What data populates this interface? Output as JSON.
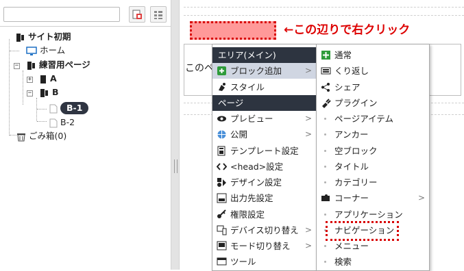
{
  "tree": {
    "nodes": [
      {
        "label": "サイト初期",
        "bold": true
      },
      {
        "label": "ホーム",
        "bold": false
      },
      {
        "label": "練習用ページ",
        "bold": true
      },
      {
        "label": "A",
        "bold": true
      },
      {
        "label": "B",
        "bold": true
      },
      {
        "label": "B-1",
        "selected": true
      },
      {
        "label": "B-2",
        "bold": false
      },
      {
        "label": "ごみ箱(0)",
        "bold": false
      }
    ]
  },
  "page": {
    "annotation": "←この辺りで右クリック",
    "content_text": "このペ"
  },
  "menu_main": {
    "items": [
      {
        "label": "エリア(メイン)",
        "type": "header",
        "icon": ""
      },
      {
        "label": "ブロック追加",
        "type": "item",
        "icon": "plus-square-icon",
        "submenu": true,
        "hover": true
      },
      {
        "label": "スタイル",
        "type": "item",
        "icon": "paint-icon"
      },
      {
        "label": "ページ",
        "type": "header",
        "icon": ""
      },
      {
        "label": "プレビュー",
        "type": "item",
        "icon": "eye-icon",
        "submenu": true
      },
      {
        "label": "公開",
        "type": "item",
        "icon": "globe-icon",
        "submenu": true
      },
      {
        "label": "テンプレート設定",
        "type": "item",
        "icon": "template-icon"
      },
      {
        "label": "<head>設定",
        "type": "item",
        "icon": "code-arrows-icon"
      },
      {
        "label": "デザイン設定",
        "type": "item",
        "icon": "design-icon"
      },
      {
        "label": "出力先設定",
        "type": "item",
        "icon": "output-icon"
      },
      {
        "label": "権限設定",
        "type": "item",
        "icon": "key-icon"
      },
      {
        "label": "デバイス切り替え",
        "type": "item",
        "icon": "device-icon",
        "submenu": true
      },
      {
        "label": "モード切り替え",
        "type": "item",
        "icon": "mode-icon",
        "submenu": true
      },
      {
        "label": "ツール",
        "type": "item",
        "icon": "tool-icon"
      }
    ]
  },
  "menu_sub": {
    "items": [
      {
        "label": "通常",
        "icon": "plus-icon"
      },
      {
        "label": "くり返し",
        "icon": "repeat-box-icon"
      },
      {
        "label": "シェア",
        "icon": "share-icon"
      },
      {
        "label": "プラグイン",
        "icon": "plugin-icon"
      },
      {
        "label": "ページアイテム",
        "icon": "dot"
      },
      {
        "label": "アンカー",
        "icon": "dot"
      },
      {
        "label": "空ブロック",
        "icon": "dot"
      },
      {
        "label": "タイトル",
        "icon": "dot"
      },
      {
        "label": "カテゴリー",
        "icon": "dot"
      },
      {
        "label": "コーナー",
        "icon": "puzzle-icon",
        "submenu": true
      },
      {
        "label": "アプリケーション",
        "icon": "dot"
      },
      {
        "label": "ナビゲーション",
        "icon": "dot",
        "highlighted": true
      },
      {
        "label": "メニュー",
        "icon": "dot"
      },
      {
        "label": "検索",
        "icon": "dot"
      }
    ]
  },
  "submenu_arrow": ">",
  "colors": {
    "header_bg": "#2d3440",
    "hover_bg": "#d0d6e2",
    "annotation": "#dd0000",
    "highlight_fill": "#ff9999",
    "accent_green": "#2e9b3a"
  }
}
